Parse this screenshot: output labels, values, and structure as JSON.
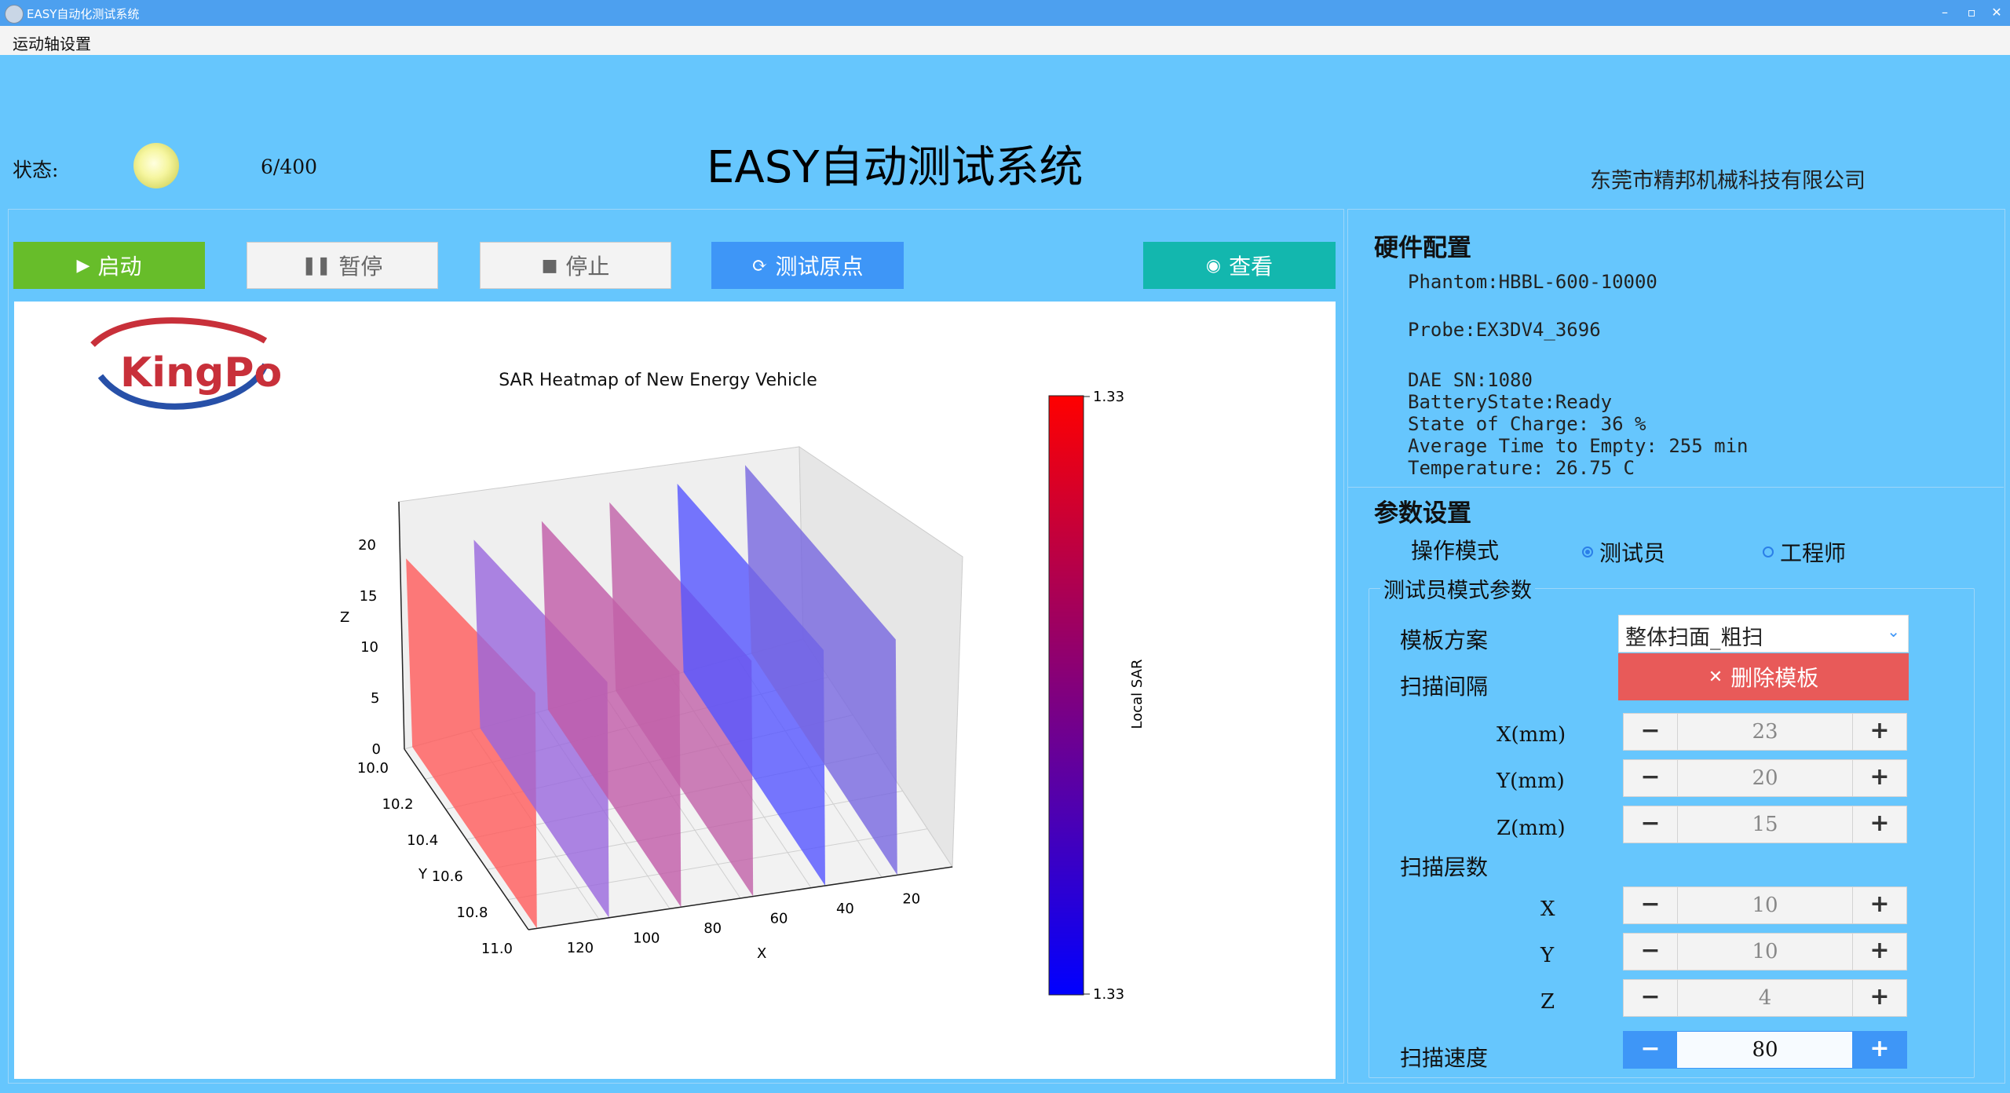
{
  "window": {
    "title": "EASY自动化测试系统",
    "controls": [
      "–",
      "▫",
      "✕"
    ]
  },
  "menu": {
    "items": [
      "运动轴设置"
    ]
  },
  "header": {
    "status_label": "状态:",
    "progress_text": "6/400",
    "title": "EASY自动测试系统",
    "company": "东莞市精邦机械科技有限公司"
  },
  "toolbar": {
    "start": "启动",
    "pause": "暂停",
    "stop": "停止",
    "origin": "测试原点",
    "view": "查看"
  },
  "logo": {
    "text": "KingPo"
  },
  "chart_data": {
    "type": "3d-planes",
    "title": "SAR Heatmap of New Energy Vehicle",
    "xlabel": "X",
    "ylabel": "Y",
    "zlabel": "Z",
    "x_ticks": [
      "120",
      "100",
      "80",
      "60",
      "40",
      "20"
    ],
    "y_ticks": [
      "10.0",
      "10.2",
      "10.4",
      "10.6",
      "10.8",
      "11.0"
    ],
    "z_ticks": [
      "0",
      "5",
      "10",
      "15",
      "20"
    ],
    "colorbar": {
      "label": "Local SAR",
      "max": "1.33",
      "min": "1.33",
      "colors": [
        "#ff0000",
        "#0000ff"
      ]
    },
    "plane_colors": [
      "#ff5a5a",
      "#9966dd",
      "#c05aa8",
      "#c060a8",
      "#5555ff",
      "#7766e0"
    ]
  },
  "hardware": {
    "title": "硬件配置",
    "phantom": "Phantom:HBBL-600-10000",
    "probe": "Probe:EX3DV4_3696",
    "dae": "DAE SN:1080",
    "battery": "BatteryState:Ready",
    "charge": "State of Charge: 36 %",
    "avg_time": "Average Time to Empty: 255 min",
    "temperature": "Temperature: 26.75 C"
  },
  "params": {
    "title": "参数设置",
    "mode_label": "操作模式",
    "mode_tester": "测试员",
    "mode_engineer": "工程师",
    "group_title": "测试员模式参数",
    "template_label": "模板方案",
    "template_value": "整体扫面_粗扫",
    "delete_template": "删除模板",
    "interval_label": "扫描间隔",
    "x_mm_label": "X(mm)",
    "y_mm_label": "Y(mm)",
    "z_mm_label": "Z(mm)",
    "x_mm": "23",
    "y_mm": "20",
    "z_mm": "15",
    "layers_label": "扫描层数",
    "x_label": "X",
    "y_label": "Y",
    "z_label": "Z",
    "x_layers": "10",
    "y_layers": "10",
    "z_layers": "4",
    "speed_label": "扫描速度",
    "speed": "80"
  }
}
